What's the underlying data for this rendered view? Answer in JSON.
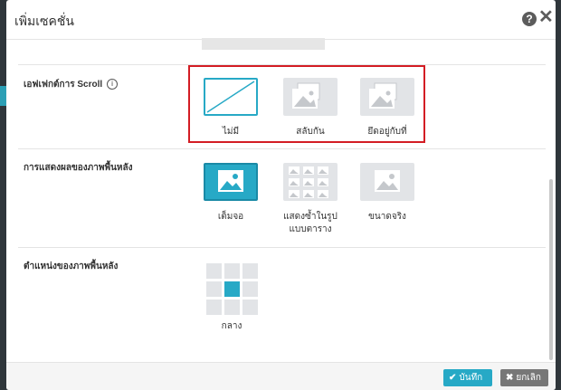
{
  "dialog": {
    "title": "เพิ่มเซคชั่น",
    "help_icon": "?",
    "close_icon": "✕"
  },
  "scroll_effect": {
    "label": "เอฟเฟกต์การ Scroll",
    "info_icon": "i",
    "options": [
      {
        "label": "ไม่มี",
        "icon": "no-image-slash-icon",
        "selected": true
      },
      {
        "label": "สลับกัน",
        "icon": "layered-images-icon",
        "selected": false
      },
      {
        "label": "ยึดอยู่กับที่",
        "icon": "layered-images-icon",
        "selected": false
      }
    ]
  },
  "background_display": {
    "label": "การแสดงผลของภาพพื้นหลัง",
    "options": [
      {
        "label": "เต็มจอ",
        "icon": "image-icon",
        "selected": true
      },
      {
        "label": "แสดงซ้ำในรูป",
        "label2": "แบบตาราง",
        "icon": "tiled-images-icon",
        "selected": false
      },
      {
        "label": "ขนาดจริง",
        "icon": "image-icon",
        "selected": false
      }
    ]
  },
  "background_position": {
    "label": "ตำแหน่งของภาพพื้นหลัง",
    "selected_label": "กลาง",
    "selected_index": 4
  },
  "footer": {
    "save_label": "บันทึก",
    "save_icon": "✔",
    "cancel_label": "ยกเลิก",
    "cancel_icon": "✖"
  },
  "colors": {
    "accent": "#27a9c6",
    "highlight_border": "#d31d24"
  }
}
